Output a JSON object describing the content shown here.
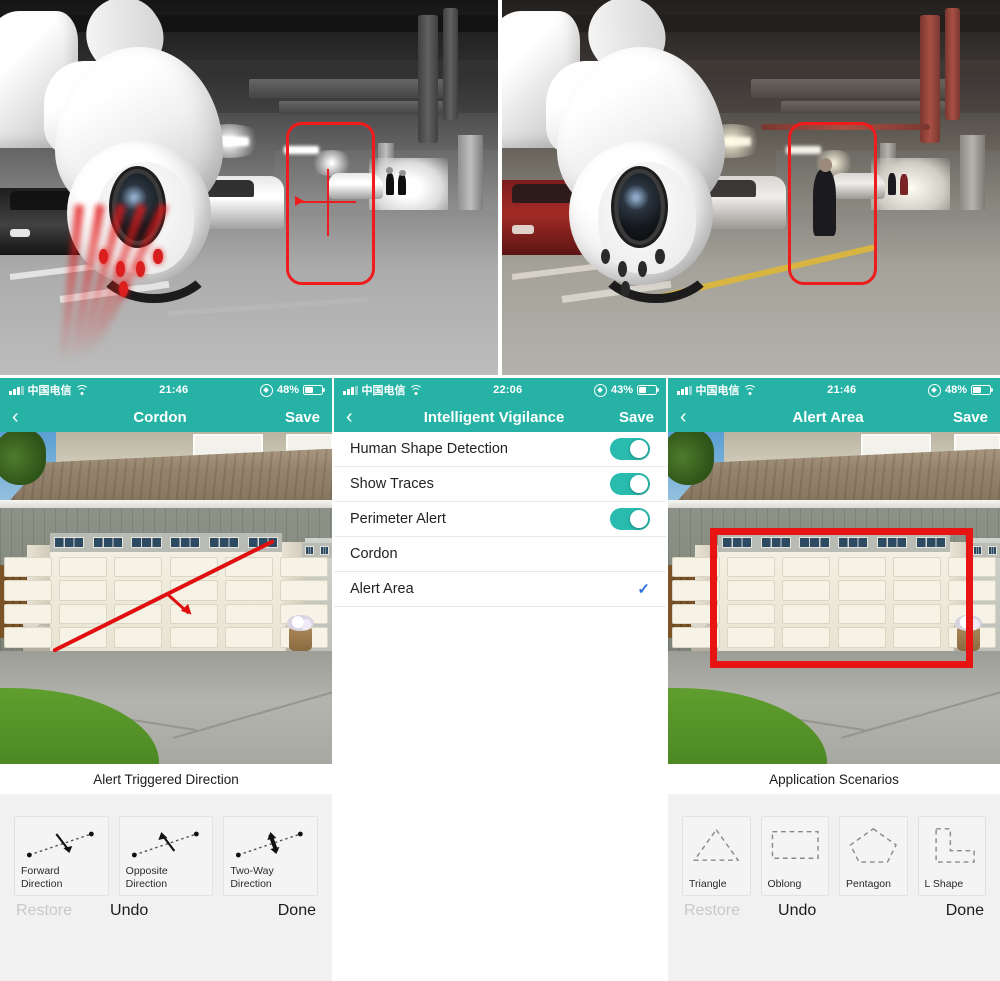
{
  "photos": [
    {
      "id": "ir-night-view",
      "alt_caption": "Night IR parking garage view with red infrared beams and detection box"
    },
    {
      "id": "day-color-view",
      "alt_caption": "Daylight parking garage view with person inside red detection box"
    }
  ],
  "colors": {
    "teal": "#26b3a6",
    "toggle_on": "#28bbae",
    "alert_red": "#e81414",
    "cordon_red": "#e01010",
    "check_blue": "#2f6fdd",
    "disabled_gray": "#c9c9c9"
  },
  "panels": [
    {
      "status": {
        "carrier": "中国电信",
        "time": "21:46",
        "battery_text": "48%",
        "battery_level": 48
      },
      "nav": {
        "back": "‹",
        "title": "Cordon",
        "save": "Save"
      },
      "caption": "Alert Triggered Direction",
      "cards": [
        {
          "label": "Forward Direction",
          "icon": "arrow-forward-direction-icon"
        },
        {
          "label": "Opposite Direction",
          "icon": "arrow-opposite-direction-icon"
        },
        {
          "label": "Two-Way Direction",
          "icon": "arrow-two-way-direction-icon"
        }
      ],
      "actions": {
        "restore": "Restore",
        "undo": "Undo",
        "done": "Done"
      }
    },
    {
      "status": {
        "carrier": "中国电信",
        "time": "22:06",
        "battery_text": "43%",
        "battery_level": 43
      },
      "nav": {
        "back": "‹",
        "title": "Intelligent Vigilance",
        "save": "Save"
      },
      "list": [
        {
          "label": "Human Shape Detection",
          "control": "toggle",
          "value": "on"
        },
        {
          "label": "Show Traces",
          "control": "toggle",
          "value": "on"
        },
        {
          "label": "Perimeter Alert",
          "control": "toggle",
          "value": "on"
        },
        {
          "label": "Cordon",
          "control": "none",
          "value": ""
        },
        {
          "label": "Alert Area",
          "control": "check",
          "value": "selected"
        }
      ]
    },
    {
      "status": {
        "carrier": "中国电信",
        "time": "21:46",
        "battery_text": "48%",
        "battery_level": 48
      },
      "nav": {
        "back": "‹",
        "title": "Alert Area",
        "save": "Save"
      },
      "caption": "Application Scenarios",
      "cards": [
        {
          "label": "Triangle",
          "icon": "triangle-shape-icon"
        },
        {
          "label": "Oblong",
          "icon": "oblong-shape-icon"
        },
        {
          "label": "Pentagon",
          "icon": "pentagon-shape-icon"
        },
        {
          "label": "L Shape",
          "icon": "l-shape-icon"
        }
      ],
      "actions": {
        "restore": "Restore",
        "undo": "Undo",
        "done": "Done"
      }
    }
  ]
}
